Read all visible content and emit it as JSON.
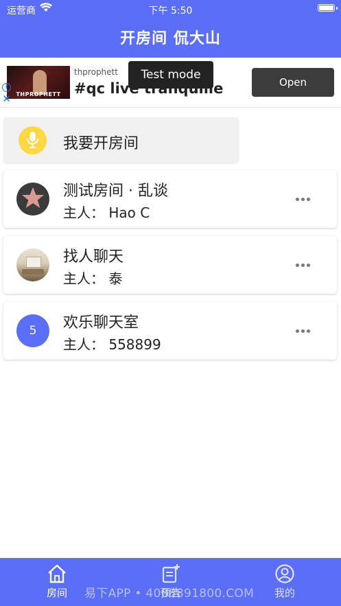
{
  "status_bar": {
    "carrier": "运营商",
    "time": "下午 5:50"
  },
  "header": {
    "title": "开房间 侃大山"
  },
  "ad": {
    "advertiser": "thprophett",
    "headline": "#qc live tranquille",
    "test_mode_label": "Test mode",
    "open_button": "Open",
    "thumb_brand": "THPROPHETT"
  },
  "create_room": {
    "label": "我要开房间"
  },
  "rooms": [
    {
      "name": "测试房间 · 乱谈",
      "host": "主人：  Hao C",
      "avatar": "star-icon"
    },
    {
      "name": "找人聊天",
      "host": "主人：  泰",
      "avatar": "room-photo"
    },
    {
      "name": "欢乐聊天室",
      "host": "主人：  558899",
      "avatar_text": "5"
    }
  ],
  "tabs": [
    {
      "label": "房间",
      "icon": "home-icon",
      "active": true
    },
    {
      "label": "预告",
      "icon": "add-note-icon",
      "active": false
    },
    {
      "label": "我的",
      "icon": "user-icon",
      "active": false
    }
  ],
  "watermark": "易下APP • 4008891800.COM",
  "colors": {
    "brand": "#5b6ef7",
    "mic": "#ffd744"
  }
}
